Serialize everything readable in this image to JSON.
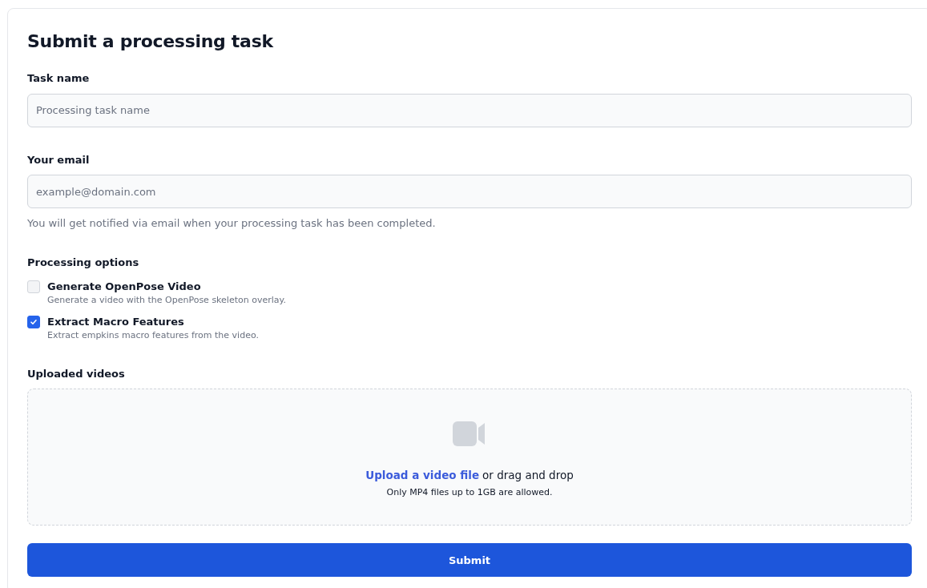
{
  "title": "Submit a processing task",
  "fields": [
    {
      "label": "Task name",
      "placeholder": "Processing task name"
    },
    {
      "label": "Your email",
      "placeholder": "example@domain.com",
      "help": "You will get notified via email when your processing task has been completed."
    }
  ],
  "options": {
    "label": "Processing options",
    "items": [
      {
        "label": "Generate OpenPose Video",
        "description": "Generate a video with the OpenPose skeleton overlay.",
        "checked": false
      },
      {
        "label": "Extract Macro Features",
        "description": "Extract empkins macro features from the video.",
        "checked": true
      }
    ]
  },
  "upload": {
    "label": "Uploaded videos",
    "link": "Upload a video file",
    "text": "or drag and drop",
    "note": "Only MP4 files up to 1GB are allowed."
  },
  "submit": "Submit"
}
